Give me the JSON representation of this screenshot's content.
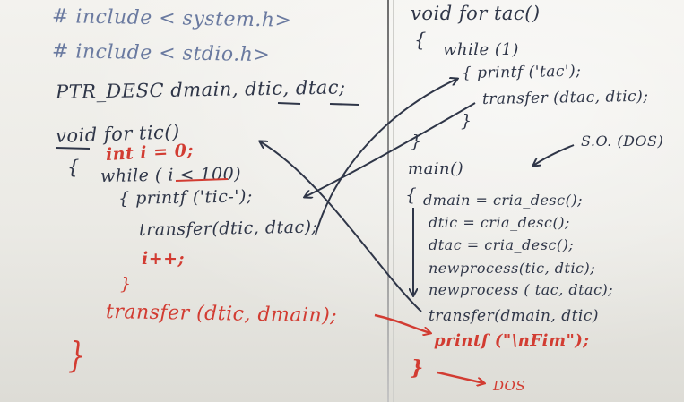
{
  "left": {
    "include1": "# include < system.h>",
    "include2": "# include < stdio.h>",
    "ptr": "PTR_DESC dmain, dtic, dtac;",
    "void_tic": "void for tic()",
    "brace_open": "{",
    "int_i": "int i = 0;",
    "while": "while ( i < 100)",
    "printf": "{ printf ('tic-');",
    "transfer": "transfer(dtic, dtac);",
    "iplus": "i++;",
    "close_inner": "}",
    "transfer_main": "transfer (dtic, dmain);",
    "close_outer": "}"
  },
  "right": {
    "void_tac": "void for tac()",
    "brace_open": "{",
    "while1": "while (1)",
    "printf_tac": "{ printf ('tac');",
    "transfer_tac": "transfer (dtac, dtic);",
    "close_inner": "}",
    "close_outer": "}",
    "so_dos": "S.O. (DOS)",
    "main": "main()",
    "main_brace": "{",
    "dmain": "dmain = cria_desc();",
    "dtic": "dtic = cria_desc();",
    "dtac": "dtac = cria_desc();",
    "newprocess1": "newprocess(tic, dtic);",
    "newprocess2": "newprocess ( tac, dtac);",
    "transfer_main": "transfer(dmain, dtic)",
    "printf_fim": "printf (\"\\nFim\");",
    "close_main": "}",
    "dos": "DOS"
  },
  "colors": {
    "board": "#ecebe6",
    "black_marker": "#2f3648",
    "purple_marker": "#6a7aa0",
    "red_marker": "#d23c32"
  }
}
